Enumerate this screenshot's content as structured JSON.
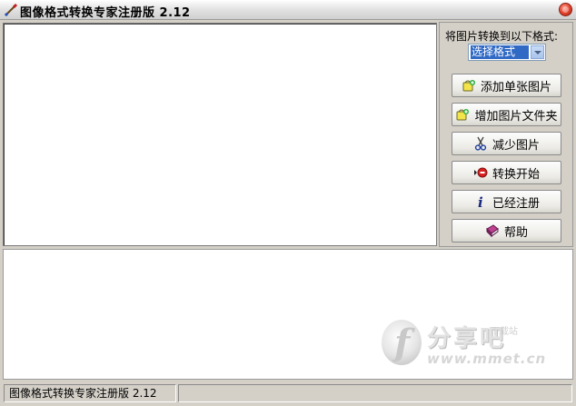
{
  "window": {
    "title": "图像格式转换专家注册版 2.12"
  },
  "format_panel": {
    "label": "将图片转换到以下格式:",
    "select_value": "选择格式"
  },
  "buttons": {
    "add_single": "添加单张图片",
    "add_folder": "增加图片文件夹",
    "remove": "减少图片",
    "start": "转换开始",
    "registered": "已经注册",
    "help": "帮助"
  },
  "watermark": {
    "brand": "分享吧",
    "sub": "下载站",
    "url": "www.mmet.cn"
  },
  "status": {
    "left": "图像格式转换专家注册版 2.12",
    "right": ""
  },
  "icons": {
    "app": "paint-brush-icon",
    "close": "close-icon",
    "add_single": "add-image-icon",
    "add_folder": "add-folder-icon",
    "remove": "scissors-icon",
    "start": "start-record-icon",
    "registered": "info-icon",
    "help": "help-book-icon"
  },
  "colors": {
    "selected": "#316ac5",
    "close": "#e0402a"
  }
}
